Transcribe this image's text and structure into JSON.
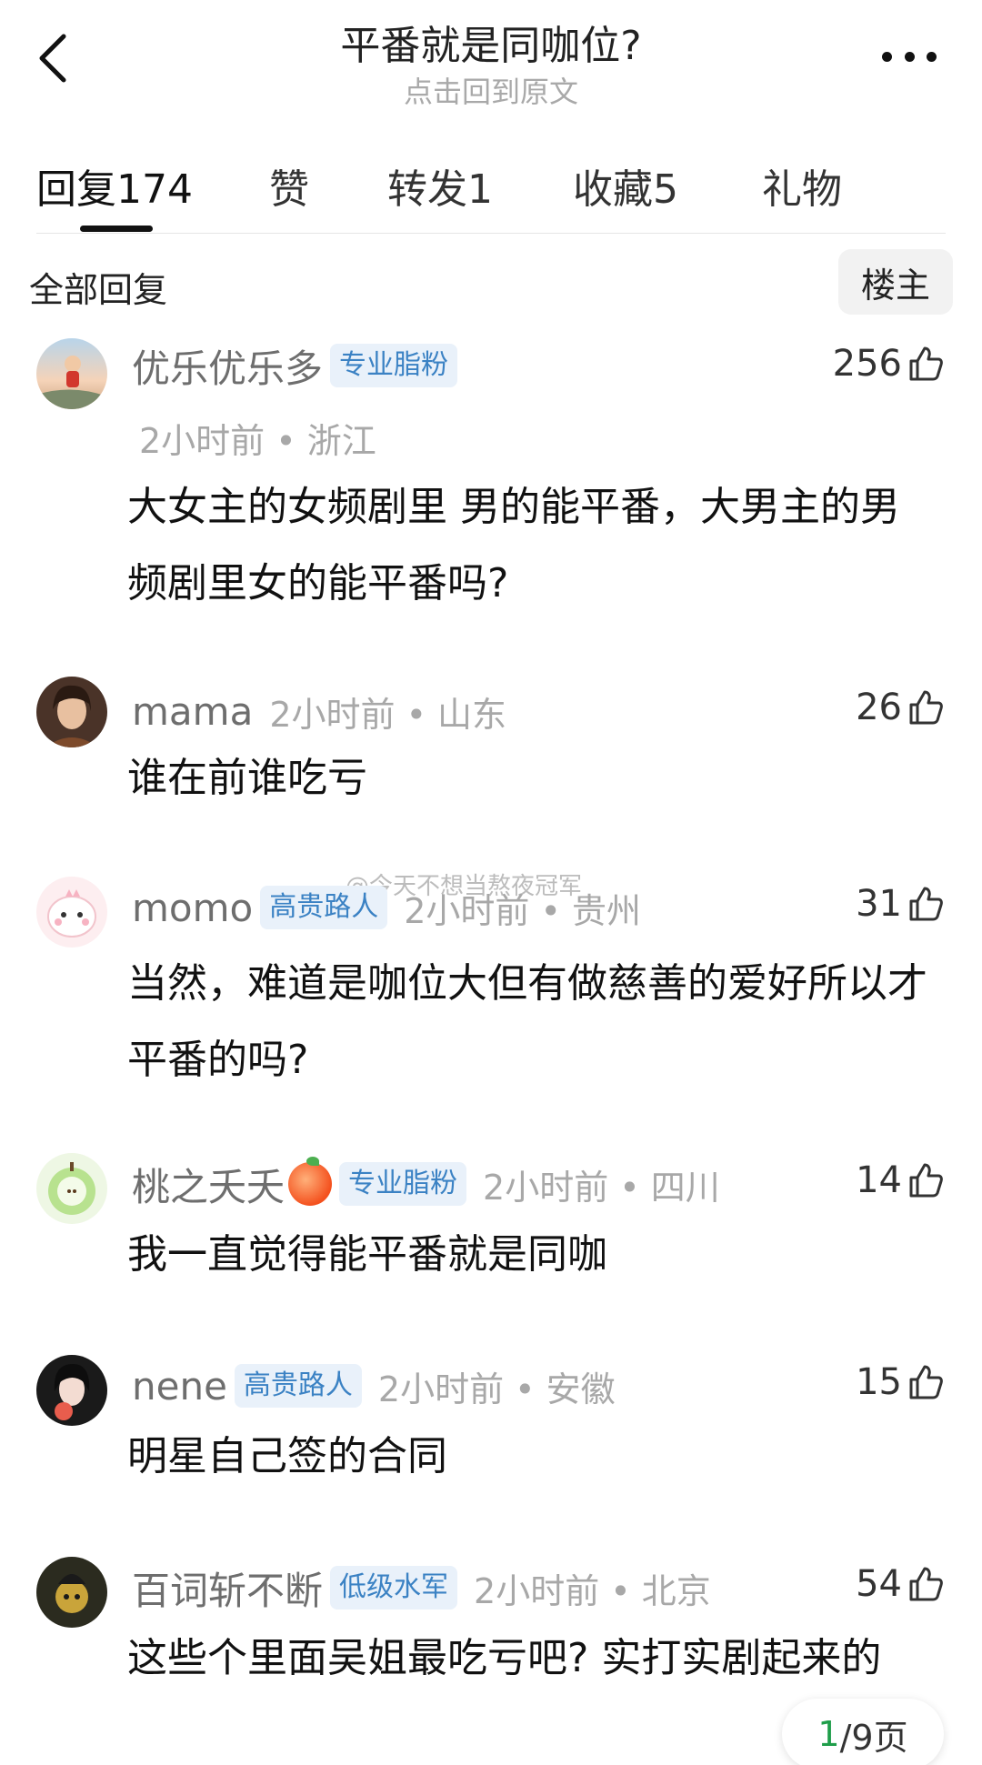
{
  "header": {
    "title": "平番就是同咖位?",
    "subtitle": "点击回到原文"
  },
  "tabs": [
    {
      "label": "回复174",
      "active": true
    },
    {
      "label": "赞"
    },
    {
      "label": "转发1"
    },
    {
      "label": "收藏5"
    },
    {
      "label": "礼物"
    }
  ],
  "section": {
    "title": "全部回复",
    "op_button": "楼主"
  },
  "comments": [
    {
      "username": "优乐优乐多",
      "badge": "专业脂粉",
      "meta": "2小时前 • 浙江",
      "likes": "256",
      "text": "大女主的女频剧里 男的能平番，大男主的男频剧里女的能平番吗?"
    },
    {
      "username": "mama",
      "meta": "2小时前 • 山东",
      "likes": "26",
      "text": "谁在前谁吃亏"
    },
    {
      "username": "momo",
      "badge": "高贵路人",
      "meta": "2小时前 • 贵州",
      "likes": "31",
      "text": "当然，难道是咖位大但有做慈善的爱好所以才平番的吗?"
    },
    {
      "username": "桃之夭夭",
      "badge": "专业脂粉",
      "meta": "2小时前 • 四川",
      "likes": "14",
      "text": "我一直觉得能平番就是同咖"
    },
    {
      "username": "nene",
      "badge": "高贵路人",
      "meta": "2小时前 • 安徽",
      "likes": "15",
      "text": "明星自己签的合同"
    },
    {
      "username": "百词斩不断",
      "badge": "低级水军",
      "meta": "2小时前 • 北京",
      "likes": "54",
      "text": "这些个里面吴姐最吃亏吧? 实打实剧起来的"
    }
  ],
  "watermark": "@今天不想当熬夜冠军",
  "pager": {
    "current": "1",
    "total": "/9页"
  }
}
